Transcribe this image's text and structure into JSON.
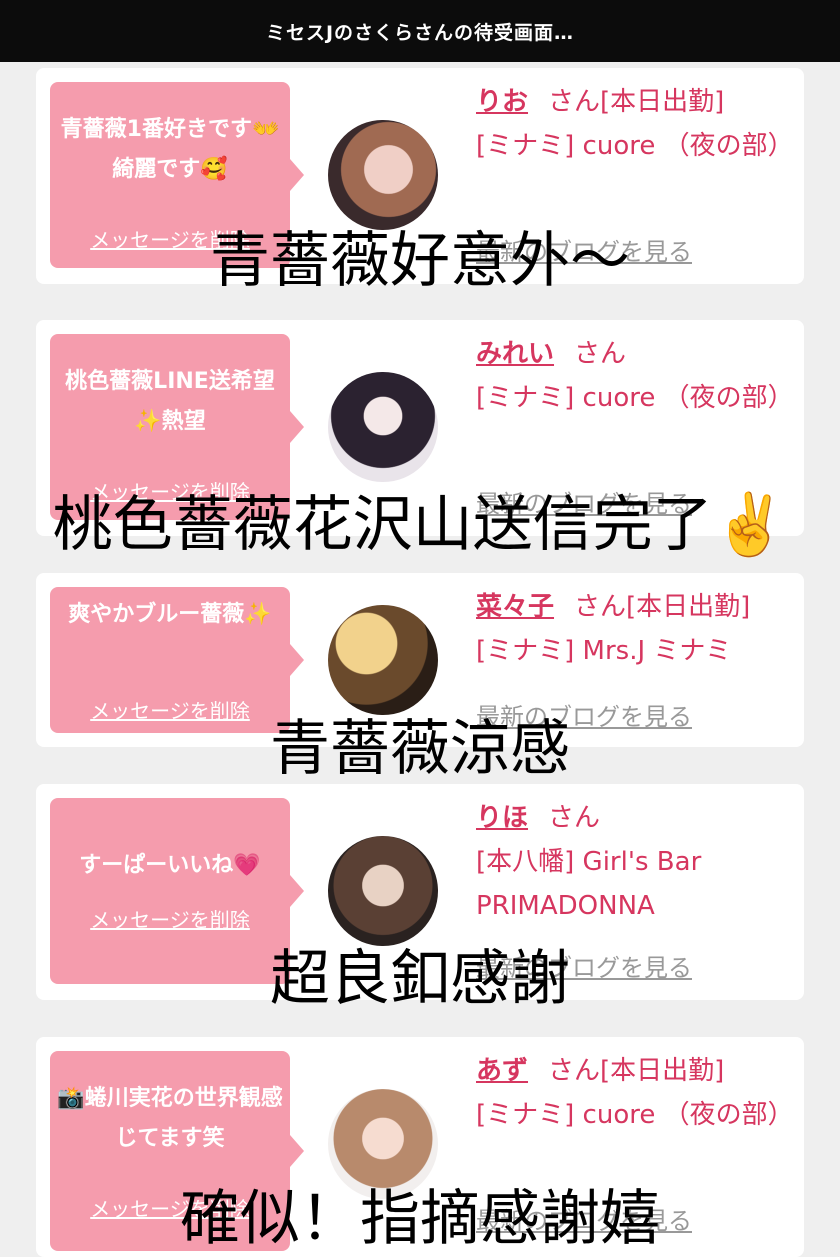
{
  "header": {
    "title": "ミセスJのさくらさんの待受画面…"
  },
  "entries": [
    {
      "message": "青薔薇1番好きです👐綺麗です🥰",
      "delete_label": "メッセージを削除",
      "name": "りお",
      "suffix": "さん[本日出勤]",
      "shop": "[ミナミ] cuore （夜の部）",
      "blog_label": "最新のブログを見る",
      "caption": "青薔薇好意外～"
    },
    {
      "message": "桃色薔薇LINE送希望✨熱望",
      "delete_label": "メッセージを削除",
      "name": "みれい",
      "suffix": "さん",
      "shop": "[ミナミ] cuore （夜の部）",
      "blog_label": "最新のブログを見る",
      "caption": "桃色薔薇花沢山送信完了✌️"
    },
    {
      "message": "爽やかブルー薔薇✨",
      "delete_label": "メッセージを削除",
      "name": "菜々子",
      "suffix": "さん[本日出勤]",
      "shop": "[ミナミ] Mrs.J ミナミ",
      "blog_label": "最新のブログを見る",
      "caption": "青薔薇涼感"
    },
    {
      "message": "すーぱーいいね💗",
      "delete_label": "メッセージを削除",
      "name": "りほ",
      "suffix": "さん",
      "shop": "[本八幡] Girl's Bar PRIMADONNA",
      "blog_label": "最新のブログを見る",
      "caption": "超良釦感謝"
    },
    {
      "message": "📸蜷川実花の世界観感じてます笑",
      "delete_label": "メッセージを削除",
      "name": "あず",
      "suffix": "さん[本日出勤]",
      "shop": "[ミナミ] cuore （夜の部）",
      "blog_label": "最新のブログを見る",
      "caption": "確似！指摘感謝嬉"
    }
  ],
  "colors": {
    "accent": "#d6365f",
    "bubble": "#f59cad",
    "topbar": "#0c0c0c"
  }
}
